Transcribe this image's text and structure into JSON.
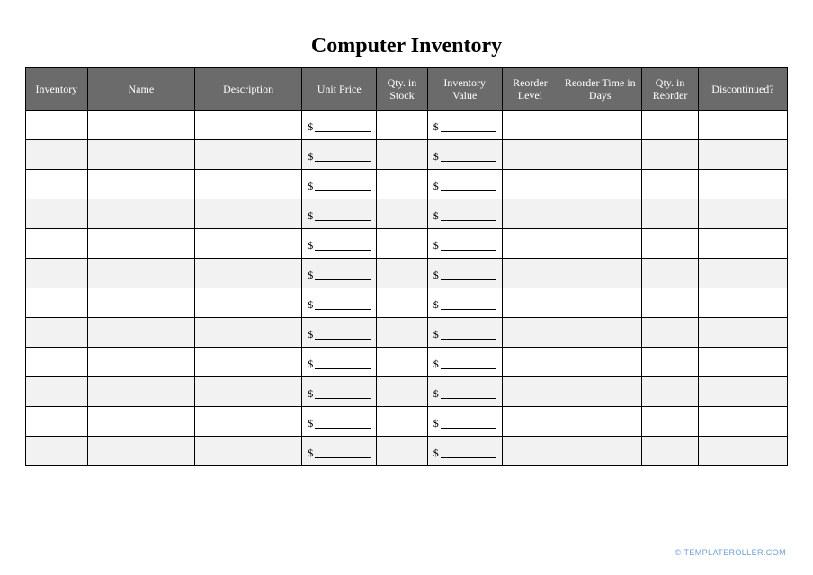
{
  "title": "Computer Inventory",
  "columns": [
    "Inventory",
    "Name",
    "Description",
    "Unit Price",
    "Qty. in Stock",
    "Inventory Value",
    "Reorder Level",
    "Reorder Time in Days",
    "Qty. in Reorder",
    "Discontinued?"
  ],
  "currency_symbol": "$",
  "row_count": 12,
  "footer": {
    "copyright": "©",
    "site": "TEMPLATEROLLER.COM"
  }
}
